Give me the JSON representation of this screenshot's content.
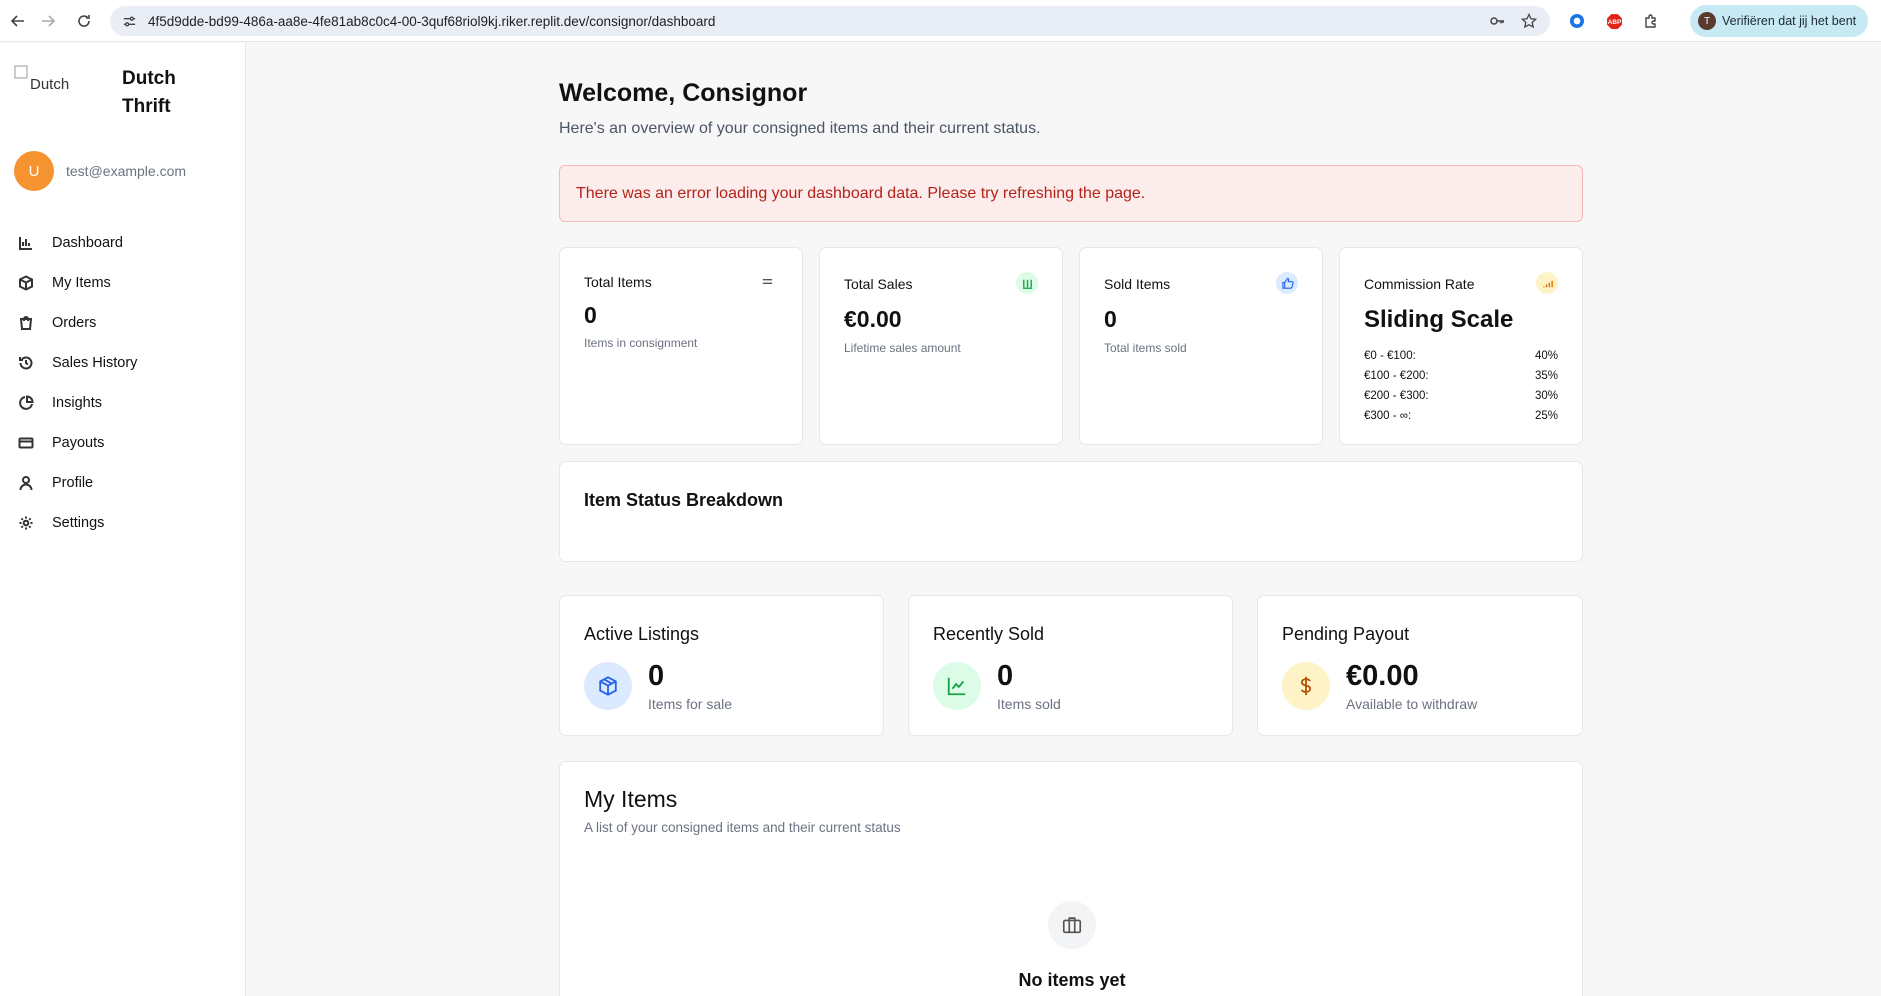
{
  "browser": {
    "url": "4f5d9dde-bd99-486a-aa8e-4fe81ab8c0c4-00-3quf68riol9kj.riker.replit.dev/consignor/dashboard",
    "profile_button": "Verifiëren dat jij het bent"
  },
  "sidebar": {
    "logo_alt": "Dutch Thrift",
    "brand_line1": "Dutch",
    "brand_line2": "Thrift",
    "user_initial": "U",
    "user_email": "test@example.com",
    "items": [
      {
        "label": "Dashboard",
        "icon": "bar-chart-icon"
      },
      {
        "label": "My Items",
        "icon": "package-icon"
      },
      {
        "label": "Orders",
        "icon": "shopping-bag-icon"
      },
      {
        "label": "Sales History",
        "icon": "history-icon"
      },
      {
        "label": "Insights",
        "icon": "pie-chart-icon"
      },
      {
        "label": "Payouts",
        "icon": "credit-card-icon"
      },
      {
        "label": "Profile",
        "icon": "user-icon"
      },
      {
        "label": "Settings",
        "icon": "gear-icon"
      }
    ]
  },
  "header": {
    "title": "Welcome, Consignor",
    "subtitle": "Here's an overview of your consigned items and their current status."
  },
  "error_message": "There was an error loading your dashboard data. Please try refreshing the page.",
  "stats": {
    "total_items": {
      "title": "Total Items",
      "value": "0",
      "caption": "Items in consignment"
    },
    "total_sales": {
      "title": "Total Sales",
      "value": "€0.00",
      "caption": "Lifetime sales amount"
    },
    "sold_items": {
      "title": "Sold Items",
      "value": "0",
      "caption": "Total items sold"
    },
    "commission": {
      "title": "Commission Rate",
      "value": "Sliding Scale",
      "tiers": [
        {
          "range": "€0 - €100:",
          "rate": "40%"
        },
        {
          "range": "€100 - €200:",
          "rate": "35%"
        },
        {
          "range": "€200 - €300:",
          "rate": "30%"
        },
        {
          "range": "€300 - ∞:",
          "rate": "25%"
        }
      ]
    }
  },
  "breakdown": {
    "title": "Item Status Breakdown"
  },
  "summary": {
    "active": {
      "title": "Active Listings",
      "value": "0",
      "caption": "Items for sale"
    },
    "sold": {
      "title": "Recently Sold",
      "value": "0",
      "caption": "Items sold"
    },
    "payout": {
      "title": "Pending Payout",
      "value": "€0.00",
      "caption": "Available to withdraw"
    }
  },
  "my_items": {
    "title": "My Items",
    "subtitle": "A list of your consigned items and their current status",
    "empty_title": "No items yet"
  },
  "colors": {
    "accent_orange": "#f59331",
    "error_bg": "#fdecec",
    "error_text": "#b42318",
    "green": "#16a34a",
    "blue": "#2563eb",
    "amber": "#d97706"
  }
}
